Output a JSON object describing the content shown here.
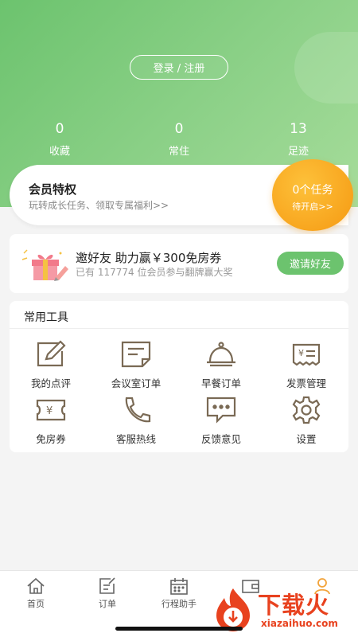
{
  "header": {
    "login_label": "登录 / 注册",
    "stats": [
      {
        "value": "0",
        "label": "收藏"
      },
      {
        "value": "0",
        "label": "常住"
      },
      {
        "value": "13",
        "label": "足迹"
      }
    ]
  },
  "member": {
    "title": "会员特权",
    "subtitle": "玩转成长任务、领取专属福利>>",
    "task_count": "0个任务",
    "task_status": "待开启>>"
  },
  "invite": {
    "title": "邀好友 助力赢￥300免房券",
    "subtitle": "已有 117774 位会员参与翻牌赢大奖",
    "button_label": "邀请好友"
  },
  "tools": {
    "title": "常用工具",
    "items": [
      {
        "label": "我的点评",
        "icon": "edit-review-icon"
      },
      {
        "label": "会议室订单",
        "icon": "meeting-order-icon"
      },
      {
        "label": "早餐订单",
        "icon": "breakfast-cloche-icon"
      },
      {
        "label": "发票管理",
        "icon": "invoice-icon"
      },
      {
        "label": "免房券",
        "icon": "coupon-icon"
      },
      {
        "label": "客服热线",
        "icon": "phone-icon"
      },
      {
        "label": "反馈意见",
        "icon": "feedback-icon"
      },
      {
        "label": "设置",
        "icon": "gear-icon"
      }
    ]
  },
  "tabbar": {
    "items": [
      {
        "label": "首页",
        "icon": "home-icon"
      },
      {
        "label": "订单",
        "icon": "order-icon"
      },
      {
        "label": "行程助手",
        "icon": "calendar-icon"
      },
      {
        "label": "",
        "icon": "wallet-icon"
      },
      {
        "label": "",
        "icon": "profile-icon"
      }
    ]
  },
  "watermark": {
    "brand": "下载火",
    "domain": "xiazaihuo.com"
  },
  "colors": {
    "primary_green": "#6cc36e",
    "accent_orange": "#f8a51e",
    "icon_brown": "#7a6a55",
    "watermark_red": "#e8421f"
  }
}
